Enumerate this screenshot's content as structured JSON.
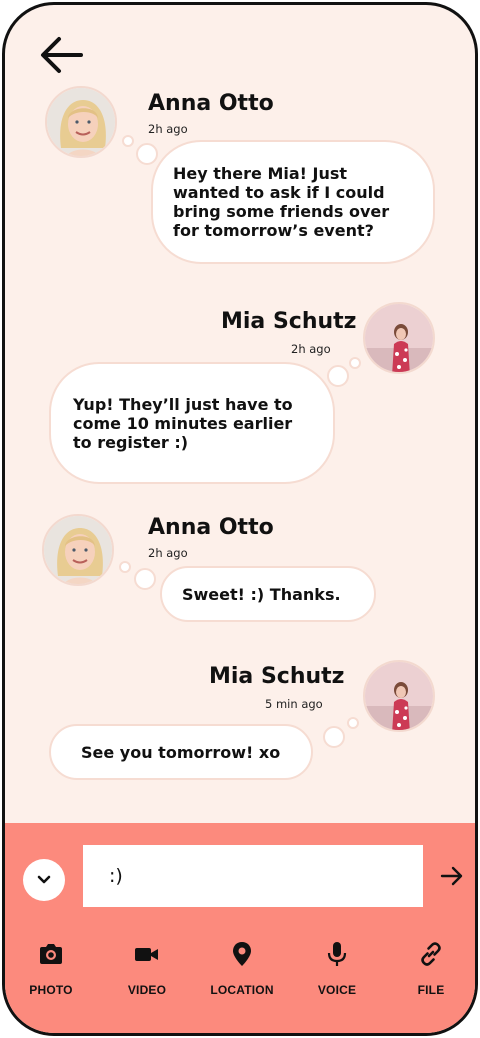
{
  "messages": [
    {
      "sender": "Anna Otto",
      "time": "2h ago",
      "text": "Hey there Mia! Just wanted to ask if I could bring some friends over for tomorrow’s event?"
    },
    {
      "sender": "Mia Schutz",
      "time": "2h ago",
      "text": "Yup! They’ll just have to come 10 minutes earlier to register :)"
    },
    {
      "sender": "Anna Otto",
      "time": "2h ago",
      "text": "Sweet! :) Thanks."
    },
    {
      "sender": "Mia Schutz",
      "time": "5 min ago",
      "text": "See you tomorrow! xo"
    }
  ],
  "composer": {
    "input_value": ":)",
    "actions": [
      {
        "label": "PHOTO",
        "icon": "camera-icon"
      },
      {
        "label": "VIDEO",
        "icon": "video-camera-icon"
      },
      {
        "label": "LOCATION",
        "icon": "location-pin-icon"
      },
      {
        "label": "VOICE",
        "icon": "microphone-icon"
      },
      {
        "label": "FILE",
        "icon": "link-icon"
      }
    ]
  },
  "colors": {
    "background": "#fdf0ea",
    "composer_background": "#fc8a7d",
    "bubble": "#ffffff",
    "bubble_border": "#f6dcd2"
  }
}
